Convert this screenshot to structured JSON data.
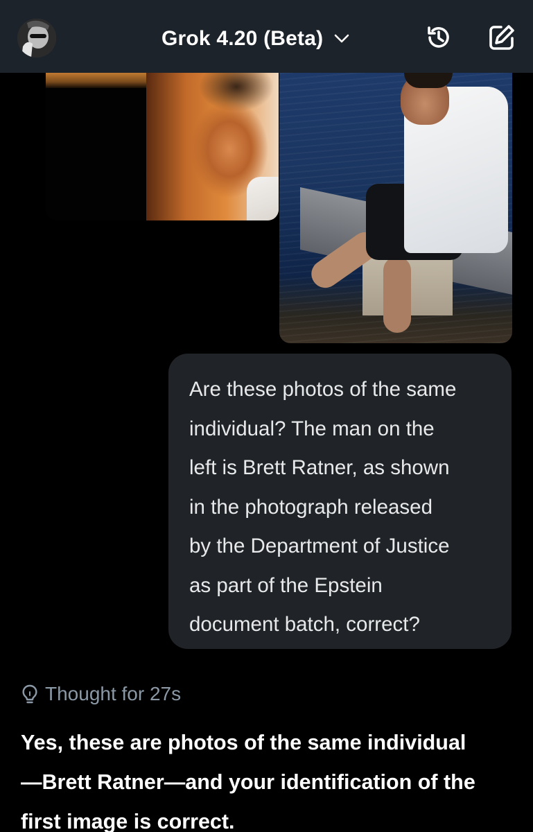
{
  "header": {
    "title": "Grok 4.20 (Beta)",
    "avatar_icon": "user-avatar",
    "chevron_icon": "chevron-down-icon",
    "history_icon": "history-icon",
    "new_chat_icon": "edit-icon",
    "background": "#1d232b"
  },
  "attachments": [
    {
      "name": "photo-left",
      "description_icon": "image"
    },
    {
      "name": "photo-right",
      "description_icon": "image"
    }
  ],
  "user_message": {
    "lines": [
      "Are these photos of the same",
      "individual? The man on the",
      "left is Brett Ratner, as shown",
      "in the photograph released",
      "by the Department of Justice",
      "as part of the Epstein",
      "document batch, correct?"
    ]
  },
  "thought": {
    "label": "Thought for 27s",
    "icon": "lightbulb-icon"
  },
  "answer": {
    "lines": [
      "Yes, these are photos of the same individual",
      "—Brett Ratner—and your identification of the",
      "first image is correct."
    ]
  },
  "colors": {
    "background": "#000000",
    "bubble": "#202327",
    "text": "#e7e9ea",
    "muted": "#8b98a5"
  }
}
